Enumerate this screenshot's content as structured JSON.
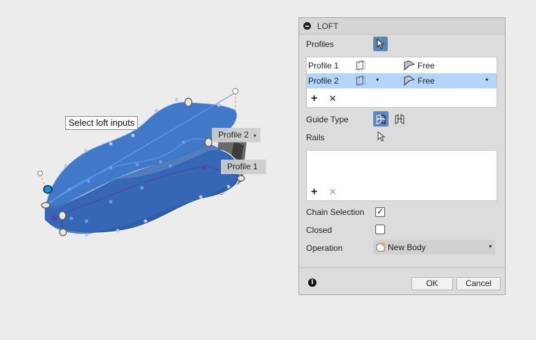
{
  "viewport": {
    "tooltip": "Select loft inputs",
    "profile2_label": "Profile 2",
    "profile2_arrow": "▾",
    "profile1_label": "Profile 1"
  },
  "dialog": {
    "title": "LOFT",
    "profiles_label": "Profiles",
    "profiles": [
      {
        "name": "Profile 1",
        "type": "Free",
        "selected": false
      },
      {
        "name": "Profile 2",
        "type": "Free",
        "selected": true
      }
    ],
    "dropdown_arrow": "▾",
    "add_glyph": "+",
    "remove_glyph": "✕",
    "guide_type_label": "Guide Type",
    "rails_label": "Rails",
    "chain_selection_label": "Chain Selection",
    "chain_selection_checked": true,
    "closed_label": "Closed",
    "closed_checked": false,
    "check_glyph": "✓",
    "operation_label": "Operation",
    "operation_value": "New Body",
    "info_glyph": "i",
    "ok_label": "OK",
    "cancel_label": "Cancel"
  },
  "colors": {
    "body_fill": "#3d6fbf",
    "selection_blue": "#5b86bb",
    "row_highlight": "#b3d4fb"
  },
  "icons": [
    "collapse-icon",
    "cursor-icon",
    "profile-plane-icon",
    "free-condition-icon",
    "guide-rails-icon",
    "guide-centerline-icon",
    "new-body-icon",
    "info-icon"
  ]
}
